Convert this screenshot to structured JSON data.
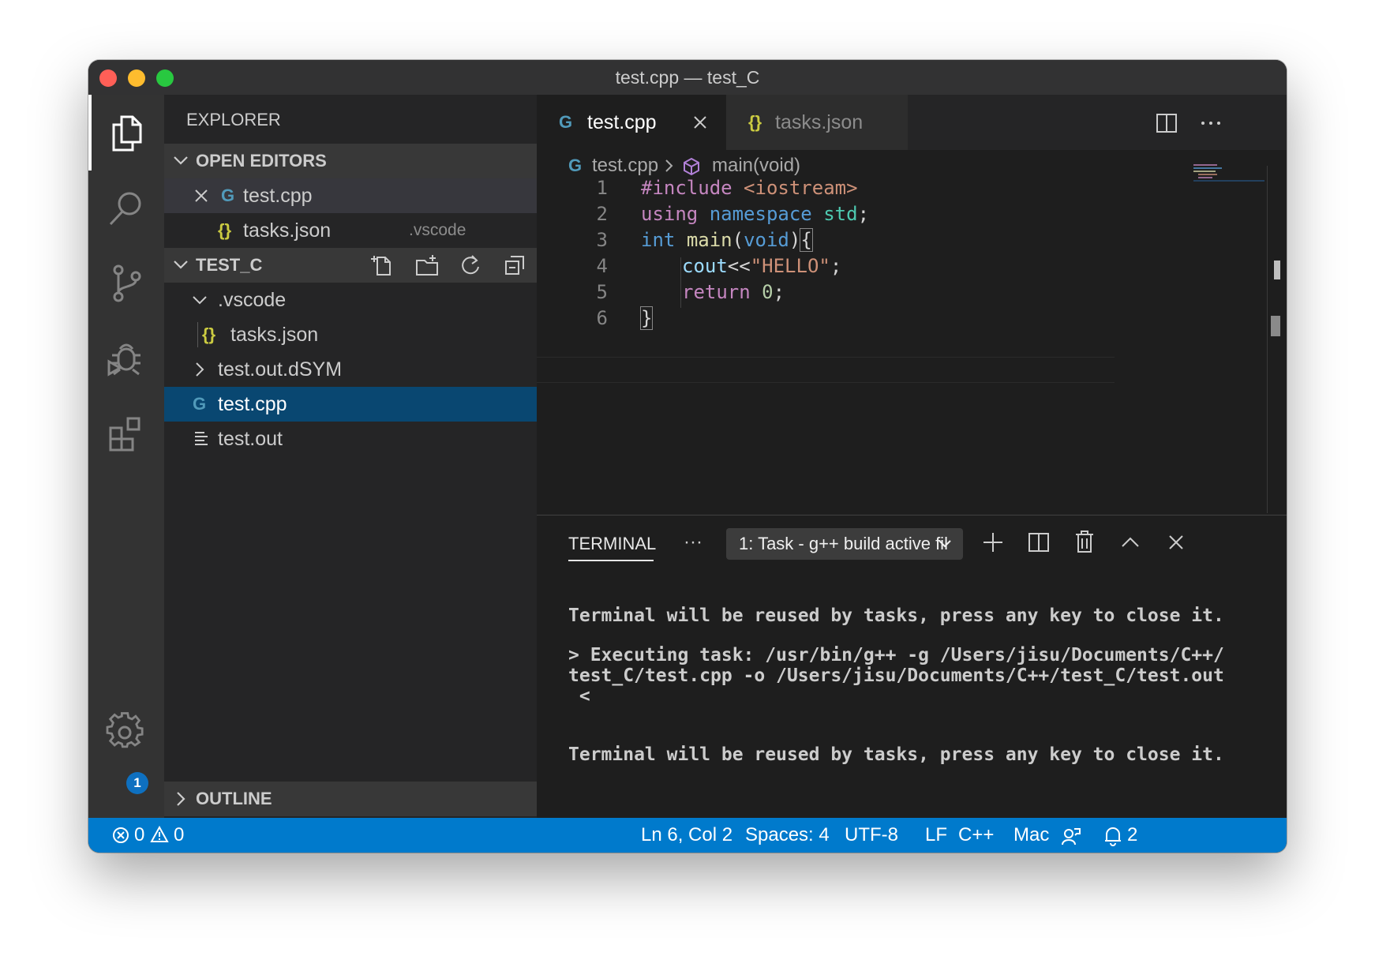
{
  "window": {
    "title": "test.cpp — test_C"
  },
  "sidebar": {
    "title": "EXPLORER",
    "open_editors": {
      "label": "OPEN EDITORS",
      "items": [
        {
          "name": "test.cpp",
          "detail": ""
        },
        {
          "name": "tasks.json",
          "detail": ".vscode"
        }
      ]
    },
    "project": {
      "label": "TEST_C",
      "tree": [
        {
          "name": ".vscode"
        },
        {
          "name": "tasks.json"
        },
        {
          "name": "test.out.dSYM"
        },
        {
          "name": "test.cpp"
        },
        {
          "name": "test.out"
        }
      ]
    },
    "outline_label": "OUTLINE"
  },
  "tabs": [
    {
      "label": "test.cpp",
      "active": true
    },
    {
      "label": "tasks.json",
      "active": false
    }
  ],
  "breadcrumb": {
    "file": "test.cpp",
    "symbol": "main(void)"
  },
  "code": {
    "line_numbers": [
      "1",
      "2",
      "3",
      "4",
      "5",
      "6"
    ],
    "tokens": {
      "l1_directive": "#include",
      "l1_header": "<iostream>",
      "l2_using": "using",
      "l2_namespace": "namespace",
      "l2_std": "std",
      "l2_semi": ";",
      "l3_int": "int",
      "l3_main": "main",
      "l3_open": "(",
      "l3_void": "void",
      "l3_close": ")",
      "l3_brace": "{",
      "l4_cout": "cout",
      "l4_op": "<<",
      "l4_string": "\"HELLO\"",
      "l4_semi": ";",
      "l5_return": "return",
      "l5_zero": "0",
      "l5_semi": ";",
      "l6_brace": "}"
    }
  },
  "panel": {
    "tab_label": "TERMINAL",
    "more": "···",
    "terminal_select": "1: Task - g++ build active fil",
    "lines": [
      "Terminal will be reused by tasks, press any key to close it.",
      "> Executing task: /usr/bin/g++ -g /Users/jisu/Documents/C++/",
      "test_C/test.cpp -o /Users/jisu/Documents/C++/test_C/test.out",
      " <",
      "Terminal will be reused by tasks, press any key to close it."
    ]
  },
  "activity_bar": {
    "settings_badge": "1"
  },
  "statusbar": {
    "errors": "0",
    "warnings": "0",
    "position": "Ln 6, Col 2",
    "spaces": "Spaces: 4",
    "encoding": "UTF-8",
    "eol": "LF",
    "language": "C++",
    "platform": "Mac",
    "notifications": "2"
  },
  "colors": {
    "accent": "#007acc",
    "selected_row": "#094771",
    "keyword": "#569cd6",
    "control": "#c586c0",
    "string": "#ce9178",
    "function": "#dcdcaa",
    "variable": "#9cdcfe",
    "type": "#4ec9b0",
    "number": "#b5cea8"
  }
}
